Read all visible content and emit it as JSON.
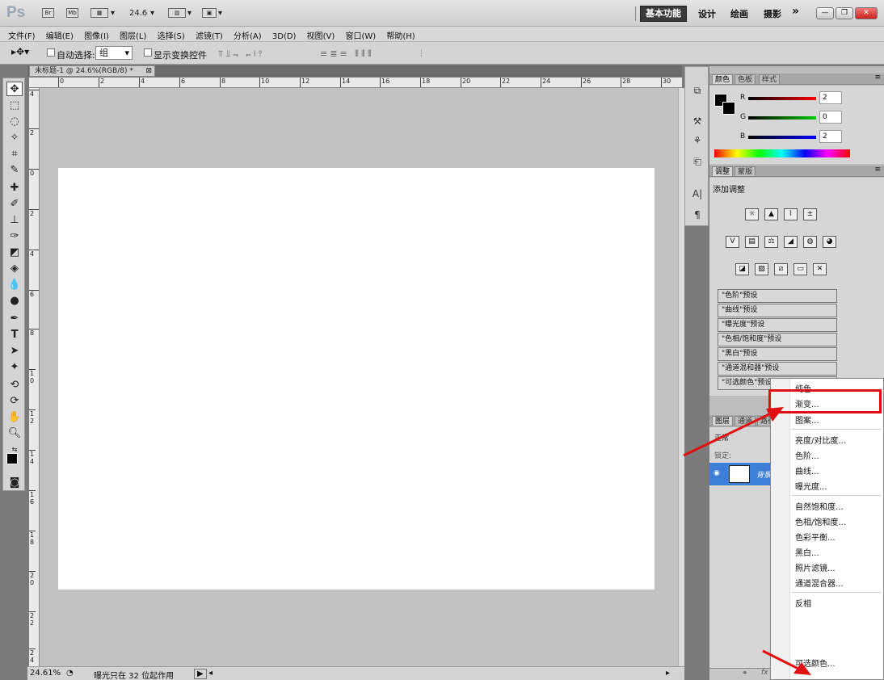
{
  "app": {
    "logo": "Ps",
    "zoom": "24.6",
    "workspaces": [
      "基本功能",
      "设计",
      "绘画",
      "摄影"
    ],
    "more": "»"
  },
  "menu": [
    "文件(F)",
    "编辑(E)",
    "图像(I)",
    "图层(L)",
    "选择(S)",
    "滤镜(T)",
    "分析(A)",
    "3D(D)",
    "视图(V)",
    "窗口(W)",
    "帮助(H)"
  ],
  "options": {
    "auto_select": "自动选择:",
    "auto_select_value": "组",
    "show_transform": "显示变换控件"
  },
  "document": {
    "tab": "未标题-1 @ 24.6%(RGB/8) *",
    "status_zoom": "24.61%",
    "status_text": "曝光只在 32 位起作用"
  },
  "ruler": {
    "top": [
      "0",
      "2",
      "4",
      "6",
      "8",
      "10",
      "12",
      "14",
      "16",
      "18",
      "20",
      "22",
      "24",
      "26",
      "28",
      "30"
    ],
    "left": [
      "4",
      "2",
      "0",
      "2",
      "4",
      "6",
      "8",
      "1 0",
      "1 2",
      "1 4",
      "1 6",
      "1 8",
      "2 0",
      "2 2",
      "2 4"
    ]
  },
  "color_panel": {
    "tabs": [
      "颜色",
      "色板",
      "样式"
    ],
    "r": "2",
    "g": "0",
    "b": "2",
    "r_label": "R",
    "g_label": "G",
    "b_label": "B"
  },
  "adjust_panel": {
    "tabs": [
      "调整",
      "蒙版"
    ],
    "title": "添加调整",
    "presets": [
      "\"色阶\"预设",
      "\"曲线\"预设",
      "\"曝光度\"预设",
      "\"色相/饱和度\"预设",
      "\"黑白\"预设",
      "\"通道混和器\"预设",
      "\"可选颜色\"预设"
    ]
  },
  "layers_panel": {
    "tabs": [
      "图层",
      "通道",
      "路径"
    ],
    "blend": "正常",
    "lock": "锁定:",
    "layer_name": "背景"
  },
  "context_menu": {
    "items": [
      "纯色...",
      "渐变...",
      "图案...",
      "亮度/对比度...",
      "色阶...",
      "曲线...",
      "曝光度...",
      "自然饱和度...",
      "色相/饱和度...",
      "色彩平衡...",
      "黑白...",
      "照片滤镜...",
      "通道混合器...",
      "反相",
      "可选颜色..."
    ]
  },
  "colors": {
    "highlight": "#e01010",
    "canvas_bg": "#c2c2c2"
  }
}
